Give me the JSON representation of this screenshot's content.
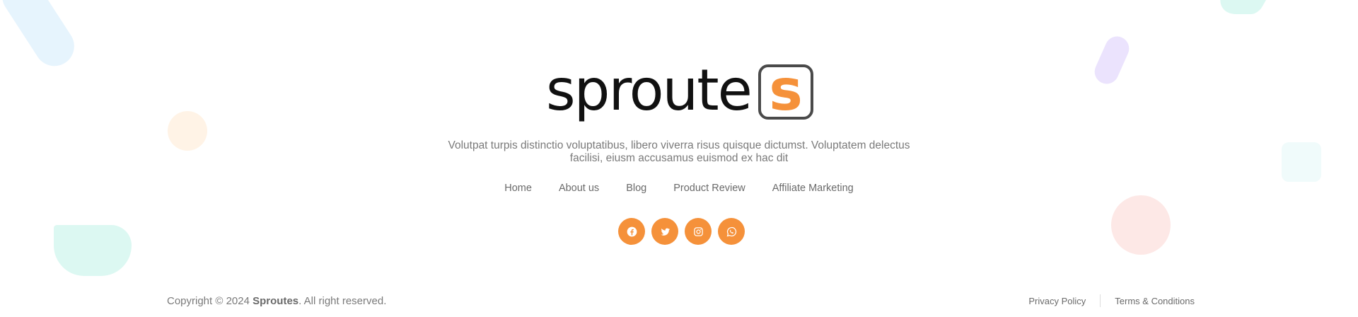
{
  "brand": {
    "logo_main": "sproute",
    "logo_last": "s",
    "accent_color": "#f5913a"
  },
  "footer": {
    "tagline_line1": "Volutpat turpis distinctio voluptatibus, libero viverra risus quisque dictumst. Voluptatem delectus",
    "tagline_line2": "facilisi, eiusm accusamus euismod ex hac dit",
    "nav": [
      {
        "label": "Home"
      },
      {
        "label": "About us"
      },
      {
        "label": "Blog"
      },
      {
        "label": "Product Review"
      },
      {
        "label": "Affiliate Marketing"
      }
    ],
    "social": [
      {
        "icon": "facebook-icon"
      },
      {
        "icon": "twitter-icon"
      },
      {
        "icon": "instagram-icon"
      },
      {
        "icon": "whatsapp-icon"
      }
    ],
    "copyright_prefix": "Copyright © 2024 ",
    "copyright_brand": "Sproutes",
    "copyright_suffix": ". All right reserved.",
    "legal": {
      "privacy": "Privacy Policy",
      "terms": "Terms & Conditions"
    }
  }
}
